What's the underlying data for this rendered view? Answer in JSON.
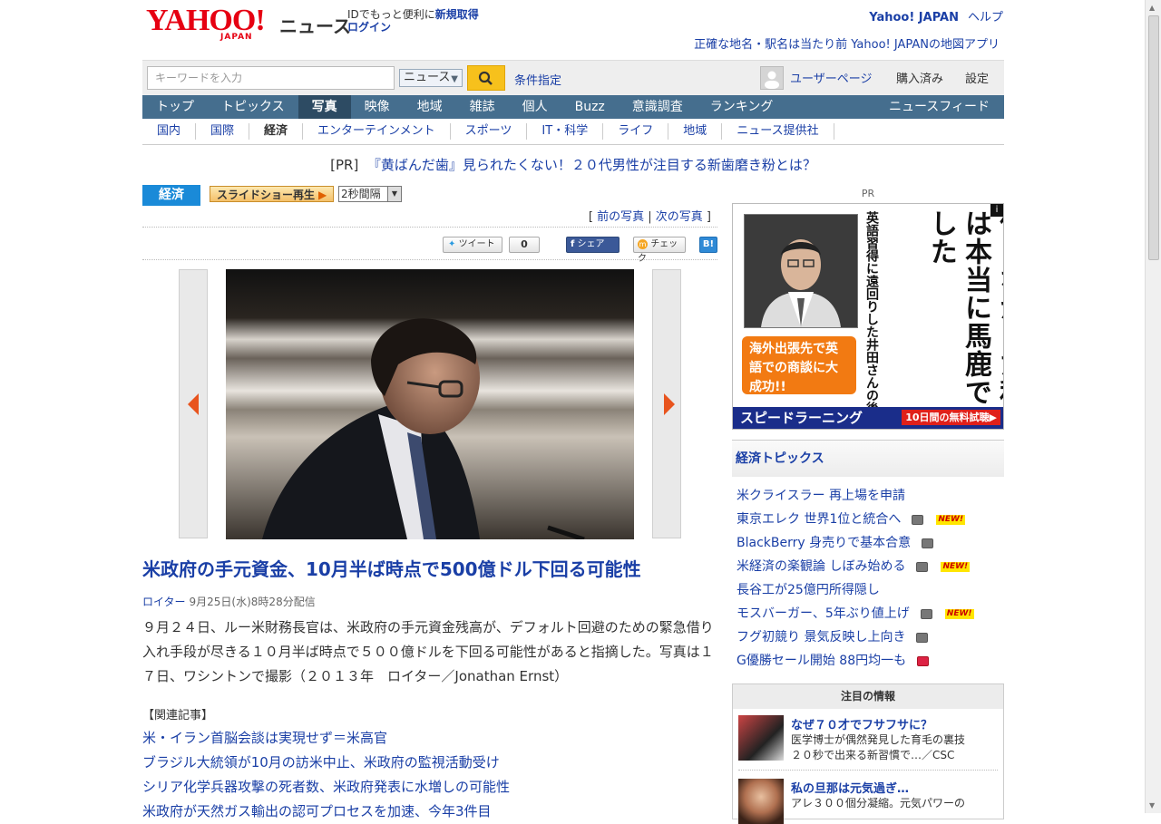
{
  "header": {
    "logo_text": "YAHOO!",
    "logo_sub": "JAPAN",
    "service": "ニュース",
    "id_text": "IDでもっと便利に",
    "register": "新規取得",
    "login": "ログイン",
    "yahoo_japan": "Yahoo! JAPAN",
    "help": "ヘルプ",
    "promo": "正確な地名・駅名は当たり前 Yahoo! JAPANの地図アプリ"
  },
  "search": {
    "placeholder": "キーワードを入力",
    "scope": "ニュース",
    "advanced": "条件指定",
    "user_page": "ユーザーページ",
    "purchased": "購入済み",
    "settings": "設定"
  },
  "nav": [
    "トップ",
    "トピックス",
    "写真",
    "映像",
    "地域",
    "雑誌",
    "個人",
    "Buzz",
    "意識調査",
    "ランキング"
  ],
  "nav_feed": "ニュースフィード",
  "subnav": [
    "国内",
    "国際",
    "経済",
    "エンターテインメント",
    "スポーツ",
    "IT・科学",
    "ライフ",
    "地域",
    "ニュース提供社"
  ],
  "ad_line": {
    "pr": "[PR]",
    "text": "『黄ばんだ歯』見られたくない！２０代男性が注目する新歯磨き粉とは？"
  },
  "article": {
    "category": "経済",
    "slideshow": "スライドショー再生",
    "interval": "2秒間隔",
    "prev_photo": "前の写真",
    "next_photo": "次の写真",
    "tweet": "ツイート",
    "tweet_count": "0",
    "share": "シェア",
    "check": "チェック",
    "hatena": "B!",
    "title": "米政府の手元資金、10月半ば時点で500億ドル下回る可能性",
    "source": "ロイター",
    "date": "9月25日(水)8時28分配信",
    "body": "９月２４日、ルー米財務長官は、米政府の手元資金残高が、デフォルト回避のための緊急借り入れ手段が尽きる１０月半ば時点で５００億ドルを下回る可能性があると指摘した。写真は１７日、ワシントンで撮影（２０１３年　ロイター／Jonathan Ernst）",
    "related_heading": "【関連記事】",
    "related": [
      "米・イラン首脳会談は実現せず＝米高官",
      "ブラジル大統領が10月の訪米中止、米政府の監視活動受け",
      "シリア化学兵器攻撃の死者数、米政府発表に水増しの可能性",
      "米政府が天然ガス輸出の認可プロセスを加速、今年3件目"
    ]
  },
  "sidebar": {
    "pr_label": "PR",
    "ad": {
      "headline": "聞き流すだけで英語が話せると信じなかった私は本当に馬鹿でした",
      "sub": "英語習得に遠回りした井田さんの後悔",
      "badge": "海外出張先で英語での商談に大成功!!",
      "brand": "スピードラーニング",
      "cta": "10日間の無料試聴▶"
    },
    "topics_title": "経済トピックス",
    "topics": [
      {
        "text": "米クライスラー 再上場を申請",
        "cam": false,
        "new": false
      },
      {
        "text": "東京エレク 世界1位と統合へ",
        "cam": true,
        "new": true
      },
      {
        "text": "BlackBerry 身売りで基本合意",
        "cam": true,
        "new": false
      },
      {
        "text": "米経済の楽観論 しぼみ始める",
        "cam": true,
        "new": true
      },
      {
        "text": "長谷工が25億円所得隠し",
        "cam": false,
        "new": false
      },
      {
        "text": "モスバーガー、5年ぶり値上げ",
        "cam": true,
        "new": true
      },
      {
        "text": "フグ初競り 景気反映し上向き",
        "cam": true,
        "new": false
      },
      {
        "text": "G優勝セール開始 88円均一も",
        "cam": "red",
        "new": false
      }
    ],
    "new_label": "NEW!",
    "attention_title": "注目の情報",
    "attention": [
      {
        "title": "なぜ７０才でフサフサに？",
        "line1": "医学博士が偶然発見した育毛の裏技",
        "line2": "２０秒で出来る新習慣で…／CSC"
      },
      {
        "title": "私の旦那は元気過ぎ…",
        "line1": "アレ３００個分凝縮。元気パワーの",
        "line2": ""
      }
    ]
  }
}
